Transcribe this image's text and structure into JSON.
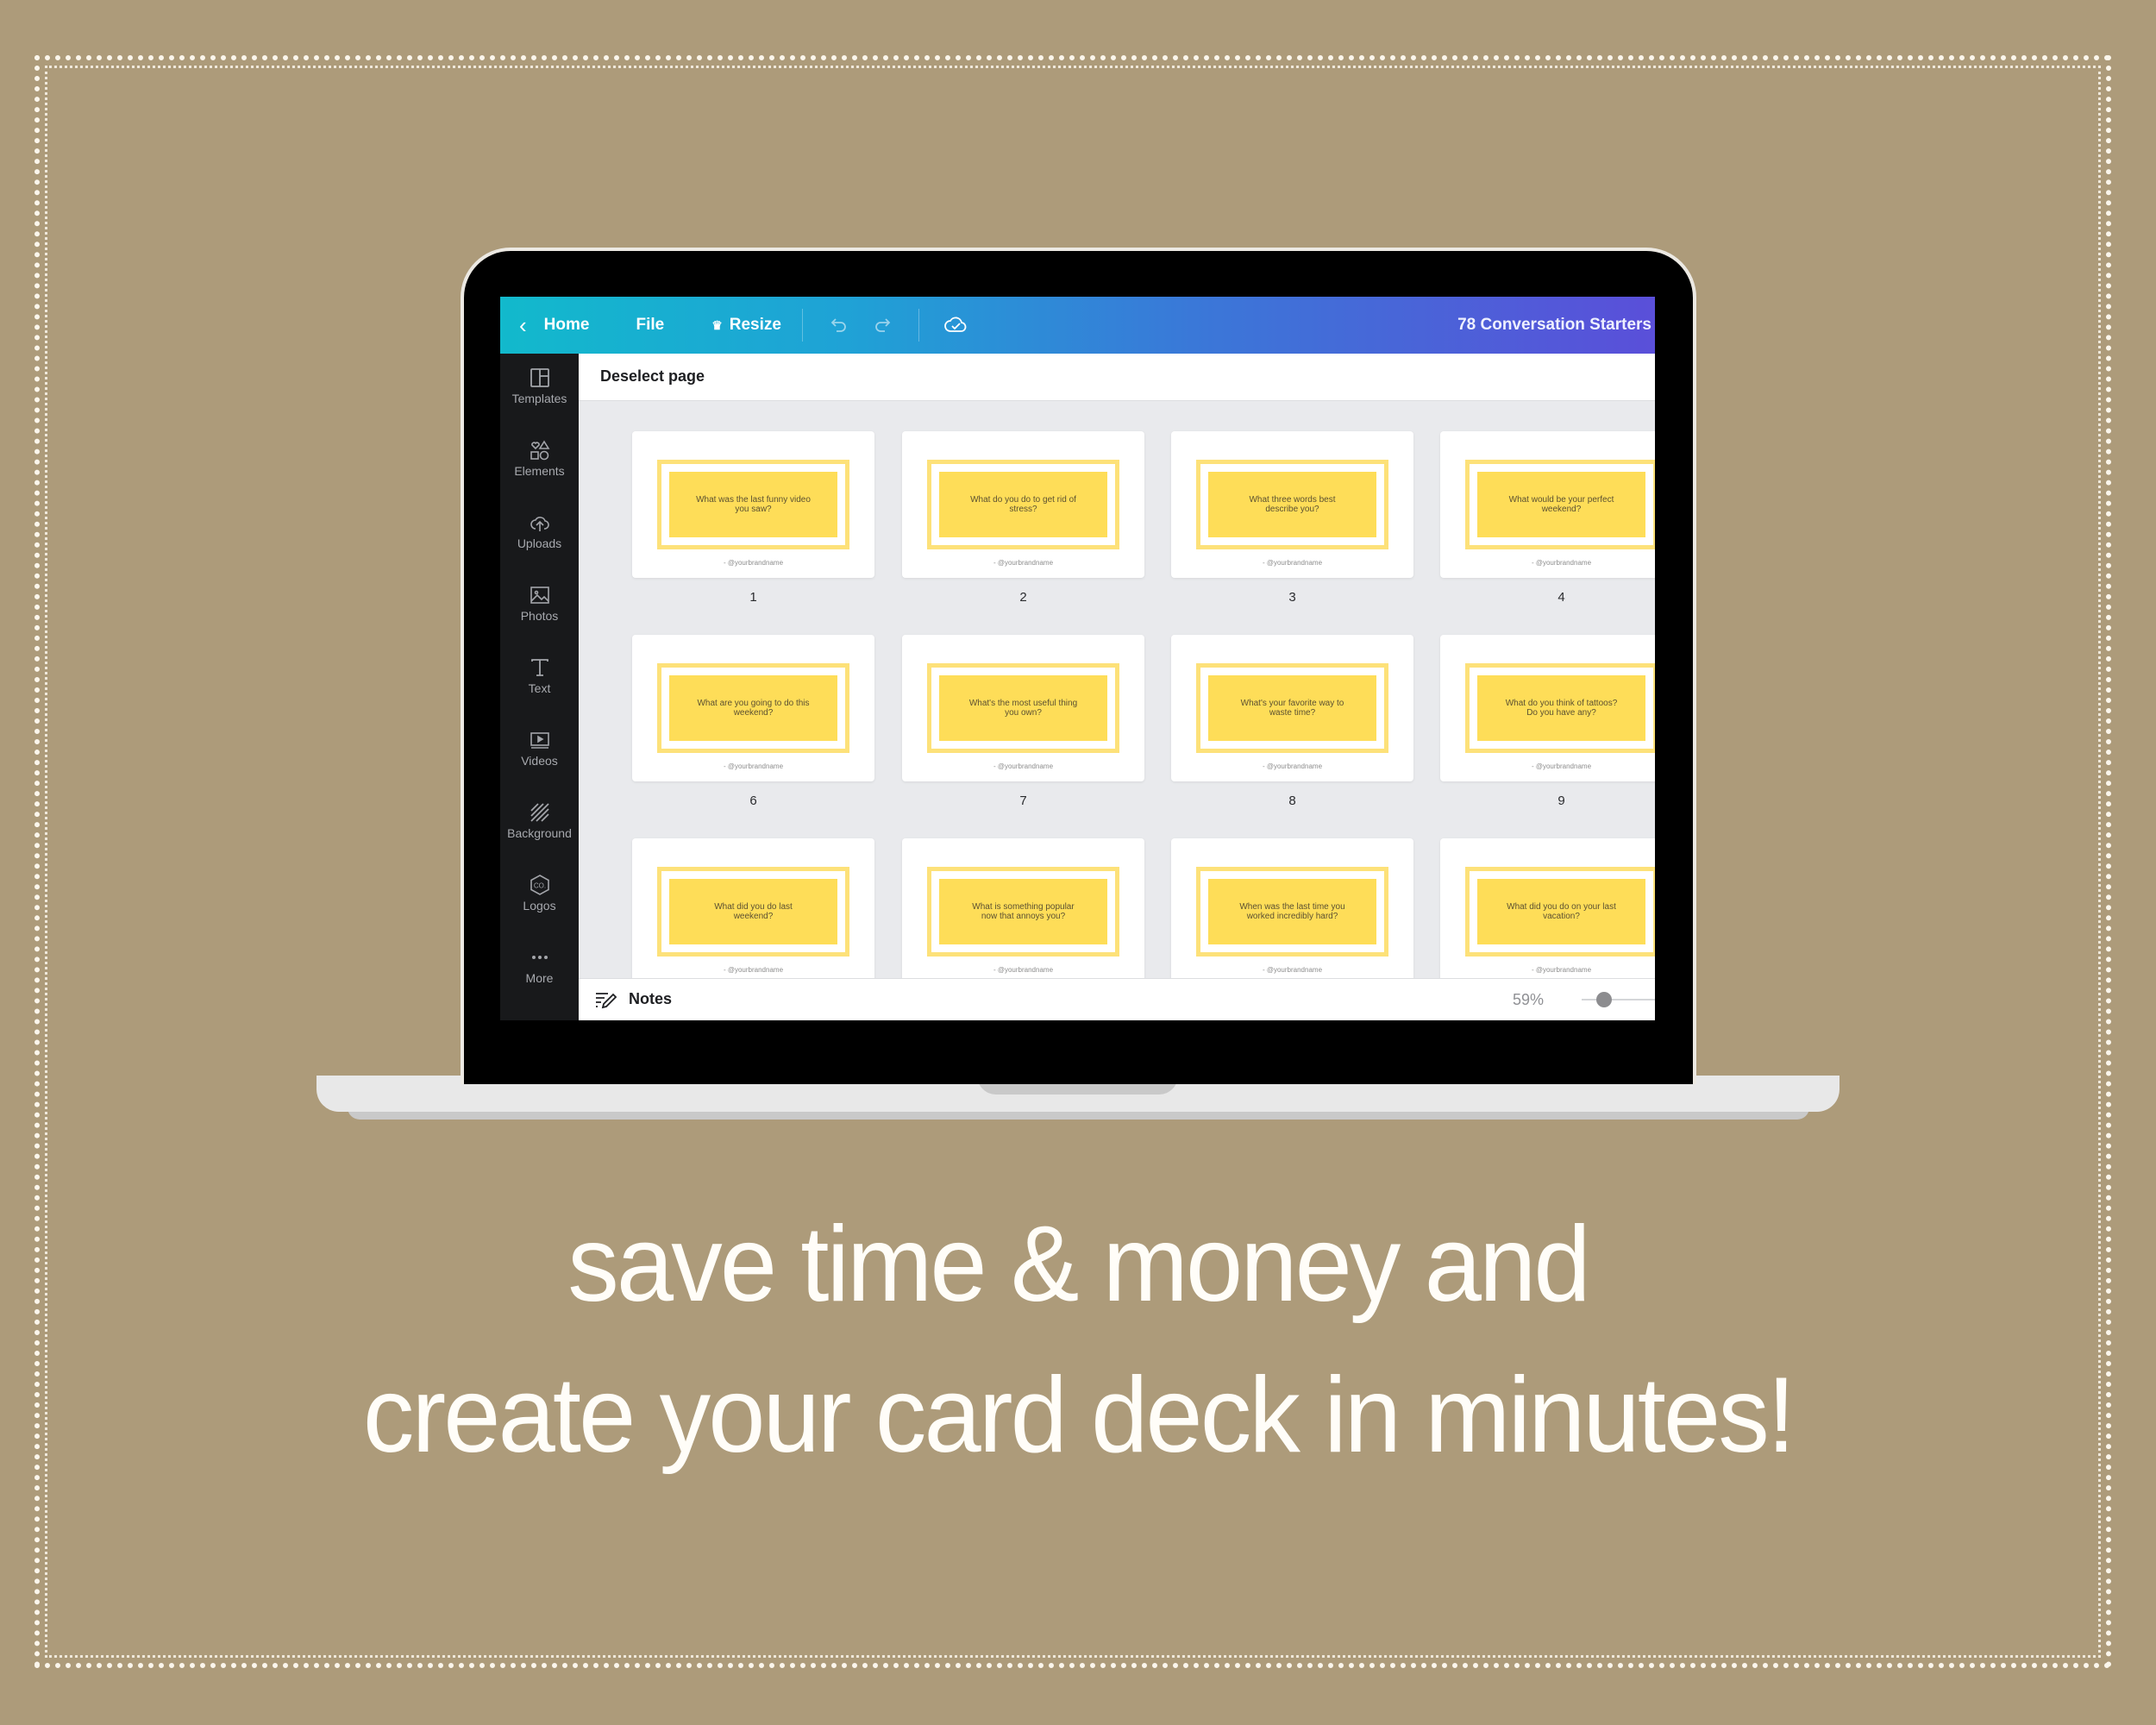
{
  "app": {
    "topbar": {
      "home_label": "Home",
      "file_label": "File",
      "resize_label": "Resize",
      "design_title": "78 Conversation Starters",
      "accent_gradient": [
        "#12b9cc",
        "#5a4fd9"
      ]
    },
    "subbar": {
      "deselect_label": "Deselect page"
    },
    "sidebar": {
      "items": [
        {
          "label": "Templates",
          "icon": "templates-icon"
        },
        {
          "label": "Elements",
          "icon": "elements-icon"
        },
        {
          "label": "Uploads",
          "icon": "upload-cloud-icon"
        },
        {
          "label": "Photos",
          "icon": "photo-icon"
        },
        {
          "label": "Text",
          "icon": "text-icon"
        },
        {
          "label": "Videos",
          "icon": "video-icon"
        },
        {
          "label": "Background",
          "icon": "background-hatch-icon"
        },
        {
          "label": "Logos",
          "icon": "logo-icon"
        },
        {
          "label": "More",
          "icon": "more-dots-icon"
        }
      ]
    },
    "pages": [
      {
        "number": "1",
        "question": "What was the last funny video you saw?",
        "brand": "- @yourbrandname"
      },
      {
        "number": "2",
        "question": "What do you do to get rid of stress?",
        "brand": "- @yourbrandname"
      },
      {
        "number": "3",
        "question": "What three words best describe you?",
        "brand": "- @yourbrandname"
      },
      {
        "number": "4",
        "question": "What would be your perfect weekend?",
        "brand": "- @yourbrandname"
      },
      {
        "number": "6",
        "question": "What are you going to do this weekend?",
        "brand": "- @yourbrandname"
      },
      {
        "number": "7",
        "question": "What's the most useful thing you own?",
        "brand": "- @yourbrandname"
      },
      {
        "number": "8",
        "question": "What's your favorite way to waste time?",
        "brand": "- @yourbrandname"
      },
      {
        "number": "9",
        "question": "What do you think of tattoos? Do you have any?",
        "brand": "- @yourbrandname"
      },
      {
        "number": "",
        "question": "What did you do last weekend?",
        "brand": "- @yourbrandname"
      },
      {
        "number": "",
        "question": "What is something popular now that annoys you?",
        "brand": "- @yourbrandname"
      },
      {
        "number": "",
        "question": "When was the last time you worked incredibly hard?",
        "brand": "- @yourbrandname"
      },
      {
        "number": "",
        "question": "What did you do on your last vacation?",
        "brand": "- @yourbrandname"
      }
    ],
    "notesbar": {
      "notes_label": "Notes",
      "zoom_label": "59%",
      "zoom_percent": 59
    }
  },
  "tagline": {
    "line1": "save time & money and",
    "line2": "create your card deck in minutes!"
  },
  "colors": {
    "background": "#ad9b7a",
    "card_yellow": "#fedd58",
    "sidebar": "#18191b"
  }
}
